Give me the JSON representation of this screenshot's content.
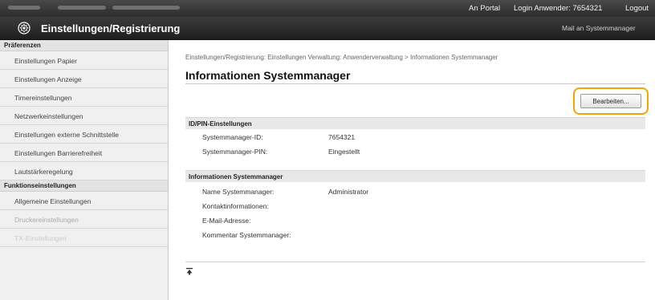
{
  "topbar": {
    "portal": "An Portal",
    "login": "Login Anwender:  7654321",
    "logout": "Logout"
  },
  "titlebar": {
    "title": "Einstellungen/Registrierung",
    "mail": "Mail an Systemmanager",
    "icon": "gear-icon"
  },
  "sidebar": {
    "section1": "Präferenzen",
    "items1": [
      "Einstellungen Papier",
      "Einstellungen Anzeige",
      "Timereinstellungen",
      "Netzwerkeinstellungen",
      "Einstellungen externe Schnittstelle",
      "Einstellungen Barrierefreiheit",
      "Lautstärkeregelung"
    ],
    "section2": "Funktionseinstellungen",
    "items2": [
      "Allgemeine Einstellungen",
      "Druckereinstellungen",
      "TX-Einstellungen"
    ]
  },
  "main": {
    "breadcrumb": "Einstellungen/Registrierung: Einstellungen Verwaltung: Anwenderverwaltung > Informationen Systemmanager",
    "title": "Informationen Systemmanager",
    "edit_button": "Bearbeiten...",
    "sections": [
      {
        "header": "ID/PIN-Einstellungen",
        "rows": [
          {
            "label": "Systemmanager-ID:",
            "value": "7654321"
          },
          {
            "label": "Systemmanager-PIN:",
            "value": "Eingestellt"
          }
        ]
      },
      {
        "header": "Informationen Systemmanager",
        "rows": [
          {
            "label": "Name Systemmanager:",
            "value": "Administrator"
          },
          {
            "label": "Kontaktinformationen:",
            "value": ""
          },
          {
            "label": "E-Mail-Adresse:",
            "value": ""
          },
          {
            "label": "Kommentar Systemmanager:",
            "value": ""
          }
        ]
      }
    ]
  },
  "colors": {
    "highlight": "#f0a800",
    "topbar": "#2b2b2b"
  }
}
